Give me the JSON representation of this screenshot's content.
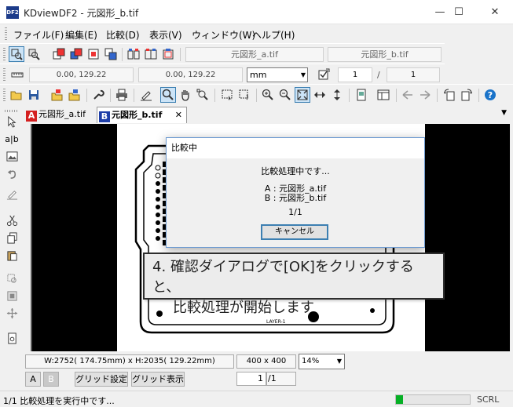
{
  "window": {
    "title": "KDviewDF2 - 元図形_b.tif",
    "minimize": "—",
    "maximize": "☐",
    "close": "✕",
    "app_icon_text": "DF2"
  },
  "menu": [
    "ファイル(F)",
    "編集(E)",
    "比較(D)",
    "表示(V)",
    "ウィンドウ(W)",
    "ヘルプ(H)"
  ],
  "toolbar1": {
    "file_a": "元図形_a.tif",
    "file_b": "元図形_b.tif"
  },
  "toolbar2": {
    "coord_a": "0.00, 129.22",
    "coord_b": "0.00, 129.22",
    "unit": "mm",
    "page_current": "1",
    "page_sep": "/",
    "page_total": "1"
  },
  "tabs": [
    {
      "letter": "A",
      "label": "元図形_a.tif",
      "color": "#d42020"
    },
    {
      "letter": "B",
      "label": "元図形_b.tif",
      "color": "#1f3fa8"
    }
  ],
  "tab_close": "✕",
  "tab_dropdown": "▼",
  "lefttools": [
    "select-arrow-icon",
    "text-ab-icon",
    "image-icon",
    "undo-icon",
    "stamp-icon",
    "scissors-icon",
    "copy-icon",
    "paste-icon",
    "zoom-area-icon",
    "compare-icon",
    "move-icon",
    "document-icon"
  ],
  "dialog": {
    "title": "比較中",
    "message": "比較処理中です...",
    "file_a": "A : 元図形_a.tif",
    "file_b": "B : 元図形_b.tif",
    "progress": "1/1",
    "cancel": "キャンセル"
  },
  "callout": {
    "line1": "4. 確認ダイアログで[OK]をクリックすると、",
    "line2": "比較処理が開始します"
  },
  "drawing_label": "LAYER-1",
  "info": {
    "dimensions": "W:2752( 174.75mm) x H:2035( 129.22mm)",
    "dpi": "400 x 400",
    "zoom": "14%"
  },
  "bottom_buttons": {
    "a": "A",
    "b": "B",
    "grid_settings": "グリッド設定",
    "grid_show": "グリッド表示",
    "page": "1",
    "page_sep": "/1"
  },
  "status": {
    "text": "1/1 比較処理を実行中です...",
    "progress": 0.1,
    "scrl": "SCRL",
    "progress_color": "#06b025"
  }
}
